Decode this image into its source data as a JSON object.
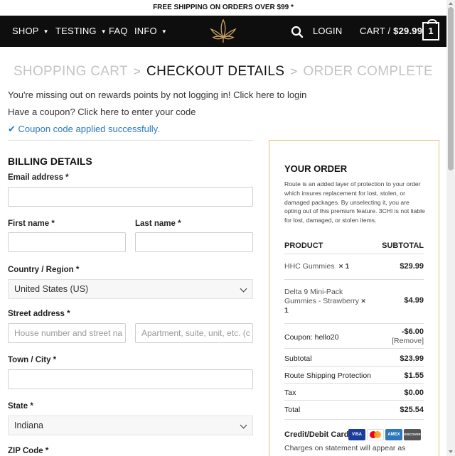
{
  "topbar": {
    "text": "FREE SHIPPING ON ORDERS OVER $99 *"
  },
  "nav": {
    "items": [
      {
        "label": "SHOP",
        "dropdown": true
      },
      {
        "label": "TESTING",
        "dropdown": true
      },
      {
        "label": "FAQ",
        "dropdown": false
      },
      {
        "label": "INFO",
        "dropdown": true
      }
    ],
    "login": "LOGIN",
    "cart_label": "CART /",
    "cart_total": "$29.99",
    "cart_count": "1",
    "logo_icon": "cannabis-leaf-logo",
    "search_icon": "search-icon",
    "accent_color": "#c9a063"
  },
  "steps": {
    "cart": "SHOPPING CART",
    "details": "CHECKOUT DETAILS",
    "complete": "ORDER COMPLETE"
  },
  "notices": {
    "login": "You're missing out on rewards points by not logging in! Click here to login",
    "coupon": "Have a coupon? Click here to enter your code",
    "success_icon": "checkmark-icon",
    "success": "Coupon code applied successfully."
  },
  "billing": {
    "title": "BILLING DETAILS",
    "email_label": "Email address *",
    "first_label": "First name *",
    "last_label": "Last name *",
    "country_label": "Country / Region *",
    "country_value": "United States (US)",
    "street_label": "Street address *",
    "street_placeholder": "House number and street na",
    "street2_placeholder": "Apartment, suite, unit, etc. (c",
    "city_label": "Town / City *",
    "state_label": "State *",
    "state_value": "Indiana",
    "zip_label": "ZIP Code *"
  },
  "order": {
    "title": "YOUR ORDER",
    "route_note": "Route is an added layer of protection to your order which insures replacement for lost, stolen, or damaged packages. By unselecting it, you are opting out of this premium feature. 3CHI is not liable for lost, damaged, or stolen items.",
    "col_product": "PRODUCT",
    "col_subtotal": "SUBTOTAL",
    "items": [
      {
        "name": "HHC Gummies",
        "qty": "× 1",
        "price": "$29.99"
      },
      {
        "name": "Delta 9 Mini-Pack Gummies - Strawberry",
        "qty": "× 1",
        "price": "$4.99"
      }
    ],
    "coupon_label": "Coupon: hello20",
    "coupon_value": "-$6.00",
    "coupon_remove": "[Remove]",
    "subtotal_label": "Subtotal",
    "subtotal_value": "$23.99",
    "shipping_label": "Route Shipping Protection",
    "shipping_value": "$1.55",
    "tax_label": "Tax",
    "tax_value": "$0.00",
    "total_label": "Total",
    "total_value": "$25.54",
    "payment_label": "Credit/Debit Card",
    "cards": [
      "VISA",
      "mastercard",
      "AMEX",
      "DISCOVER"
    ],
    "charges_note": "Charges on statement will appear as"
  }
}
